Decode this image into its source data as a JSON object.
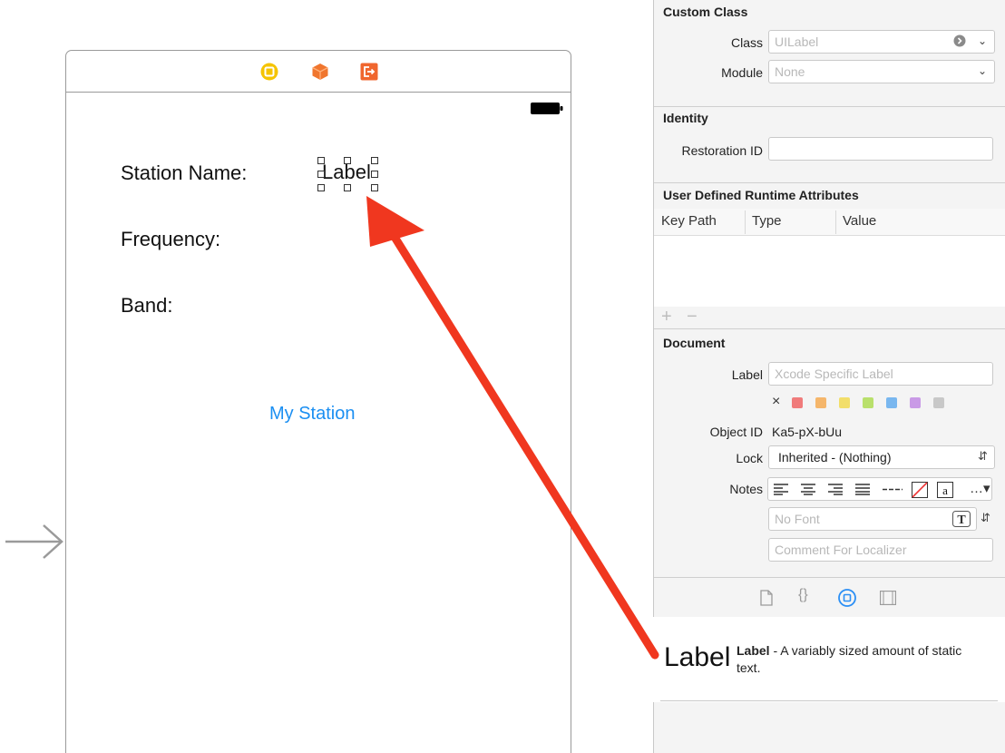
{
  "storyboard": {
    "labels": {
      "station_name": "Station Name:",
      "frequency": "Frequency:",
      "band": "Band:"
    },
    "selected_label_text": "Label",
    "button_text": "My Station",
    "dock_icons": [
      "view-controller-icon",
      "first-responder-icon",
      "exit-icon"
    ],
    "colors": {
      "button_tint": "#1b8ff2",
      "callout_arrow": "#f0371f"
    }
  },
  "inspector": {
    "custom_class": {
      "title": "Custom Class",
      "class_label": "Class",
      "class_placeholder": "UILabel",
      "module_label": "Module",
      "module_placeholder": "None"
    },
    "identity": {
      "title": "Identity",
      "restoration_id_label": "Restoration ID",
      "restoration_id_value": ""
    },
    "runtime_attributes": {
      "title": "User Defined Runtime Attributes",
      "columns": [
        "Key Path",
        "Type",
        "Value"
      ],
      "add": "+",
      "remove": "−"
    },
    "document": {
      "title": "Document",
      "label_label": "Label",
      "label_placeholder": "Xcode Specific Label",
      "clear_color": "×",
      "color_swatches": [
        "#f07b7b",
        "#f5b66b",
        "#f2de6a",
        "#b9e06c",
        "#79b7ef",
        "#c99ae6",
        "#c8c8c8"
      ],
      "object_id_label": "Object ID",
      "object_id_value": "Ka5-pX-bUu",
      "lock_label": "Lock",
      "lock_value": "Inherited - (Nothing)",
      "notes_label": "Notes",
      "font_placeholder": "No Font",
      "comment_placeholder": "Comment For Localizer"
    },
    "library": {
      "big_label": "Label",
      "title": "Label",
      "description": " - A variably sized amount of static text."
    }
  }
}
